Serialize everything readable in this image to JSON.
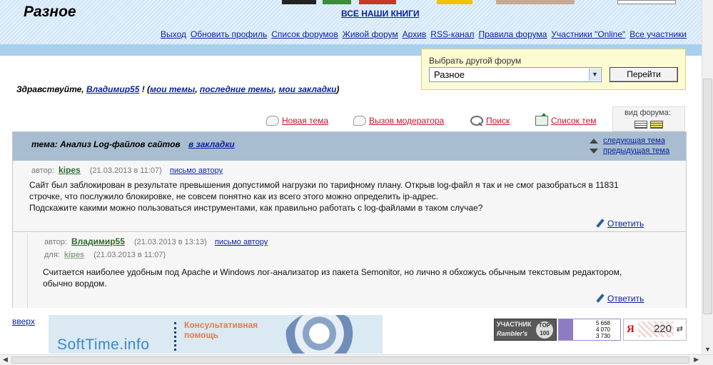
{
  "header": {
    "site_title": "Разное",
    "all_books_link": "ВСЕ НАШИ КНИГИ",
    "nav": [
      "Выход",
      "Обновить профиль",
      "Список форумов",
      "Живой форум",
      "Архив",
      "RSS-канал",
      "Правила форума",
      "Участники \"Online\"",
      "Все участники"
    ]
  },
  "forum_switch": {
    "label": "Выбрать другой форум",
    "selected": "Разное",
    "go_button": "Перейти"
  },
  "greeting": {
    "prefix": "Здравствуйте,",
    "user": "Владимир55",
    "mid": "! (",
    "my_topics": "мои темы",
    "sep1": ",",
    "last_topics": "последние темы",
    "sep2": ",",
    "bookmarks": "мои закладки",
    "suffix": ")"
  },
  "actions": {
    "new_topic": "Новая тема",
    "call_moderator": "Вызов модератора",
    "search": "Поиск",
    "topic_list": "Список тем",
    "view_label": "вид форума:"
  },
  "topic": {
    "title": "тема: Анализ Log-файлов сайтов",
    "bookmark": "в закладки",
    "next": "следующая тема",
    "prev": "предыдущая тема"
  },
  "posts": [
    {
      "author_label": "автор:",
      "author": "kipes",
      "date": "(21.03.2013 в 11:07)",
      "mail": "письмо автору",
      "lines": [
        "Сайт был заблокирован в результате превышения допустимой нагрузки по тарифному плану. Открыв log-файл я так и не смог разобраться в 11831",
        "строчке, что послужило блокировке, не совсем понятно как из всего этого можно определить ip-адрес.",
        "Подскажите какими можно пользоваться инструментами, как правильно работать с log-файлами в таком случае?"
      ],
      "reply": "Ответить"
    },
    {
      "author_label": "автор:",
      "author": "Владимир55",
      "date": "(21.03.2013 в 13:13)",
      "mail": "письмо автору",
      "re_label": "для:",
      "re_author": "kipes",
      "re_date": "(21.03.2013 в 11:07)",
      "lines": [
        "Считается наиболее удобным под Apache и Windows лог-анализатор из пакета Semonitor, но лично я обхожусь обычным текстовым редактором,",
        "обычно вордом."
      ],
      "reply": "Ответить"
    }
  ],
  "footer": {
    "up_link": "вверх",
    "softtime_name": "SoftTime.info",
    "softtime_line1": "Консультативная",
    "softtime_line2": "помощь",
    "rambler_a": "УЧАСТНИК",
    "rambler_b": "Rambler's",
    "rambler_c": "TOP 100",
    "stats": [
      "5 668",
      "4 070",
      "3 730"
    ],
    "yandex_letter": "Я",
    "yandex_num": "220"
  },
  "colors": {
    "link": "#0b1f9e",
    "action_link": "#c0182a",
    "topic_bar": "#a8bed0",
    "author": "#2d6b2d"
  }
}
